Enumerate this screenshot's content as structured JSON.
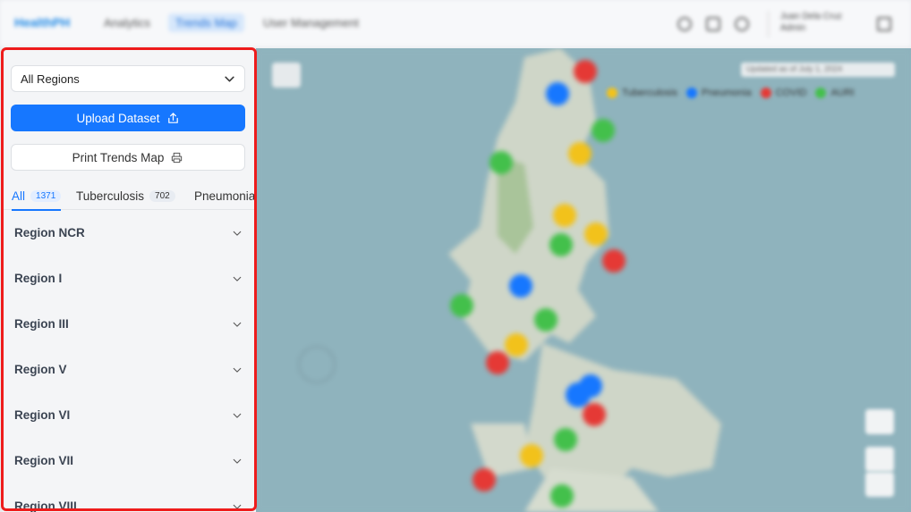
{
  "topnav": {
    "brand": "HealthPH",
    "links": [
      "Analytics",
      "Trends Map",
      "User Management"
    ],
    "user_name": "Juan Dela Cruz",
    "user_role": "Admin"
  },
  "sidebar": {
    "region_filter": {
      "value": "All Regions"
    },
    "upload_label": "Upload Dataset",
    "print_label": "Print Trends Map",
    "tabs": [
      {
        "label": "All",
        "count": "1371"
      },
      {
        "label": "Tuberculosis",
        "count": "702"
      },
      {
        "label": "Pneumonia",
        "count": ""
      }
    ],
    "regions": [
      "Region NCR",
      "Region I",
      "Region III",
      "Region V",
      "Region VI",
      "Region VII",
      "Region VIII"
    ]
  },
  "map": {
    "updated_text": "Updated as of July 1, 2024",
    "legend": [
      {
        "label": "Tuberculosis",
        "color": "#f2c21b"
      },
      {
        "label": "Pneumonia",
        "color": "#1677ff"
      },
      {
        "label": "COVID",
        "color": "#e53935"
      },
      {
        "label": "AURI",
        "color": "#43c04b"
      }
    ]
  },
  "colors": {
    "accent": "#1677ff",
    "highlight_border": "#ee1c1c"
  }
}
